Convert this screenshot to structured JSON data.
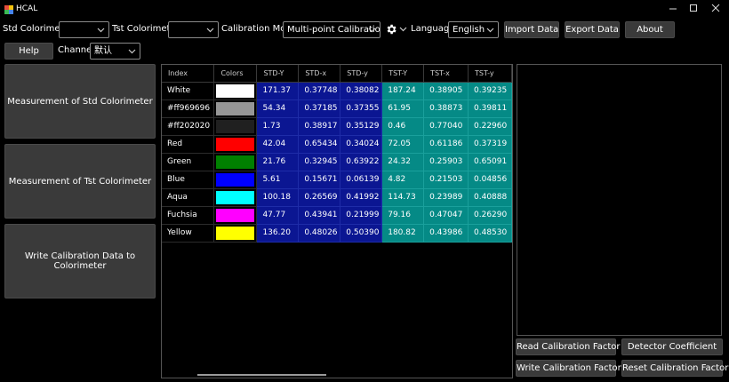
{
  "window": {
    "title": "HCAL",
    "controls": [
      "minimize-icon",
      "maximize-icon",
      "close-icon"
    ]
  },
  "toolbar": {
    "std_label": "Std Colorimeter:",
    "std_value": "",
    "tst_label": "Tst Colorimeter:",
    "tst_value": "",
    "mode_label": "Calibration Mode:",
    "mode_value": "Multi-point Calibration",
    "language_label": "Language:",
    "language_value": "English",
    "import_label": "Import Data",
    "export_label": "Export Data",
    "about_label": "About",
    "help_label": "Help",
    "channel_label": "Channel:",
    "channel_value": "默认"
  },
  "left_panel": {
    "measure_std": "Measurement of Std Colorimeter",
    "measure_tst": "Measurement of Tst Colorimeter",
    "write_cal": "Write Calibration Data to Colorimeter"
  },
  "table": {
    "headers": [
      "Index",
      "Colors",
      "STD-Y",
      "STD-x",
      "STD-y",
      "TST-Y",
      "TST-x",
      "TST-y"
    ],
    "rows": [
      {
        "index": "White",
        "color": "#ffffff",
        "std_Y": "171.37",
        "std_x": "0.37748",
        "std_y": "0.38082",
        "tst_Y": "187.24",
        "tst_x": "0.38905",
        "tst_y": "0.39235"
      },
      {
        "index": "#ff969696",
        "color": "#969696",
        "std_Y": "54.34",
        "std_x": "0.37185",
        "std_y": "0.37355",
        "tst_Y": "61.95",
        "tst_x": "0.38873",
        "tst_y": "0.39811"
      },
      {
        "index": "#ff202020",
        "color": "#202020",
        "std_Y": "1.73",
        "std_x": "0.38917",
        "std_y": "0.35129",
        "tst_Y": "0.46",
        "tst_x": "0.77040",
        "tst_y": "0.22960"
      },
      {
        "index": "Red",
        "color": "#ff0000",
        "std_Y": "42.04",
        "std_x": "0.65434",
        "std_y": "0.34024",
        "tst_Y": "72.05",
        "tst_x": "0.61186",
        "tst_y": "0.37319"
      },
      {
        "index": "Green",
        "color": "#008000",
        "std_Y": "21.76",
        "std_x": "0.32945",
        "std_y": "0.63922",
        "tst_Y": "24.32",
        "tst_x": "0.25903",
        "tst_y": "0.65091"
      },
      {
        "index": "Blue",
        "color": "#0000ff",
        "std_Y": "5.61",
        "std_x": "0.15671",
        "std_y": "0.06139",
        "tst_Y": "4.82",
        "tst_x": "0.21503",
        "tst_y": "0.04856"
      },
      {
        "index": "Aqua",
        "color": "#00ffff",
        "std_Y": "100.18",
        "std_x": "0.26569",
        "std_y": "0.41992",
        "tst_Y": "114.73",
        "tst_x": "0.23989",
        "tst_y": "0.40888"
      },
      {
        "index": "Fuchsia",
        "color": "#ff00ff",
        "std_Y": "47.77",
        "std_x": "0.43941",
        "std_y": "0.21999",
        "tst_Y": "79.16",
        "tst_x": "0.47047",
        "tst_y": "0.26290"
      },
      {
        "index": "Yellow",
        "color": "#ffff00",
        "std_Y": "136.20",
        "std_x": "0.48026",
        "std_y": "0.50390",
        "tst_Y": "180.82",
        "tst_x": "0.43986",
        "tst_y": "0.48530"
      }
    ]
  },
  "right_panel": {
    "read_factor": "Read Calibration Factor",
    "detector_coeff": "Detector Coefficient",
    "write_factor": "Write Calibration Factor",
    "reset_factor": "Reset Calibration Factor"
  },
  "colors": {
    "std_cell_bg": "#0b1692",
    "tst_cell_bg": "#058a86",
    "button_bg": "#3a3a3a"
  }
}
